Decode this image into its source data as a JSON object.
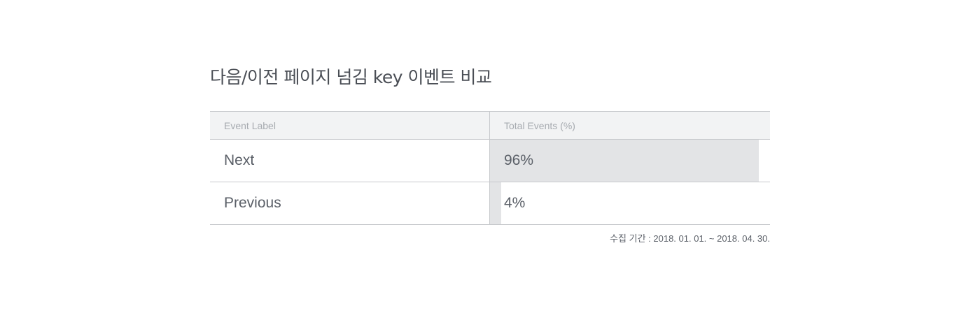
{
  "title": "다음/이전 페이지 넘김 key 이벤트 비교",
  "table": {
    "headers": {
      "label": "Event Label",
      "value": "Total Events (%)"
    }
  },
  "chart_data": {
    "type": "bar",
    "title": "다음/이전 페이지 넘김 key 이벤트 비교",
    "categories": [
      "Next",
      "Previous"
    ],
    "values": [
      96,
      4
    ],
    "value_labels": [
      "96%",
      "4%"
    ],
    "unit": "%",
    "xlim": [
      0,
      100
    ]
  },
  "footnote": "수집 기간 : 2018. 01. 01. ~ 2018. 04. 30."
}
